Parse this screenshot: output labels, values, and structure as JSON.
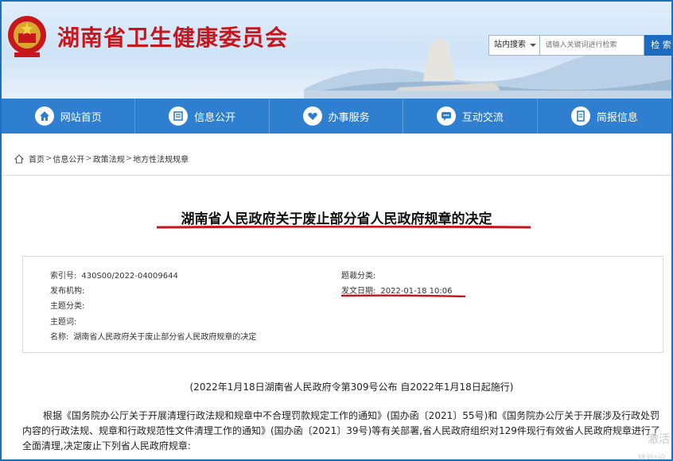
{
  "header": {
    "site_title": "湖南省卫生健康委员会",
    "search": {
      "scope_label": "站内搜索",
      "placeholder": "请输入关键词进行检索",
      "button_label": "检 索"
    }
  },
  "nav": {
    "items": [
      {
        "label": "网站首页",
        "icon": "home-icon"
      },
      {
        "label": "信息公开",
        "icon": "document-icon"
      },
      {
        "label": "办事服务",
        "icon": "heart-hand-icon"
      },
      {
        "label": "互动交流",
        "icon": "chat-icon"
      },
      {
        "label": "简报信息",
        "icon": "report-icon"
      }
    ]
  },
  "breadcrumb": {
    "items": [
      "首页",
      "信息公开",
      "政策法规",
      "地方性法规规章"
    ],
    "separator": ">"
  },
  "article": {
    "title": "湖南省人民政府关于废止部分省人民政府规章的决定",
    "meta": {
      "index_label": "索引号:",
      "index_value": "430S00/2022-04009644",
      "topic_label": "题裁分类:",
      "topic_value": "",
      "publisher_label": "发布机构:",
      "publisher_value": "",
      "date_label": "发文日期:",
      "date_value": "2022-01-18 10:06",
      "subject_label": "主题分类:",
      "subject_value": "",
      "keywords_label": "主题词:",
      "keywords_value": "",
      "name_label": "名称:",
      "name_value": "湖南省人民政府关于废止部分省人民政府规章的决定"
    },
    "decree_line": "(2022年1月18日湖南省人民政府令第309号公布 自2022年1月18日起施行)",
    "paragraph": "根据《国务院办公厅关于开展清理行政法规和规章中不合理罚款规定工作的通知》(国办函〔2021〕55号)和《国务院办公厅关于开展涉及行政处罚内容的行政法规、规章和行政规范性文件清理工作的通知》(国办函〔2021〕39号)等有关部署,省人民政府组织对129件现行有效省人民政府规章进行了全面清理,决定废止下列省人民政府规章:"
  },
  "overlay": {
    "watermark_line1": "激活",
    "watermark_line2": "转到\"设"
  },
  "colors": {
    "brand_red": "#c8161d",
    "nav_blue": "#2e7fd0",
    "annotation_red": "#c8161d",
    "frame_blue": "#1f6fbf"
  }
}
